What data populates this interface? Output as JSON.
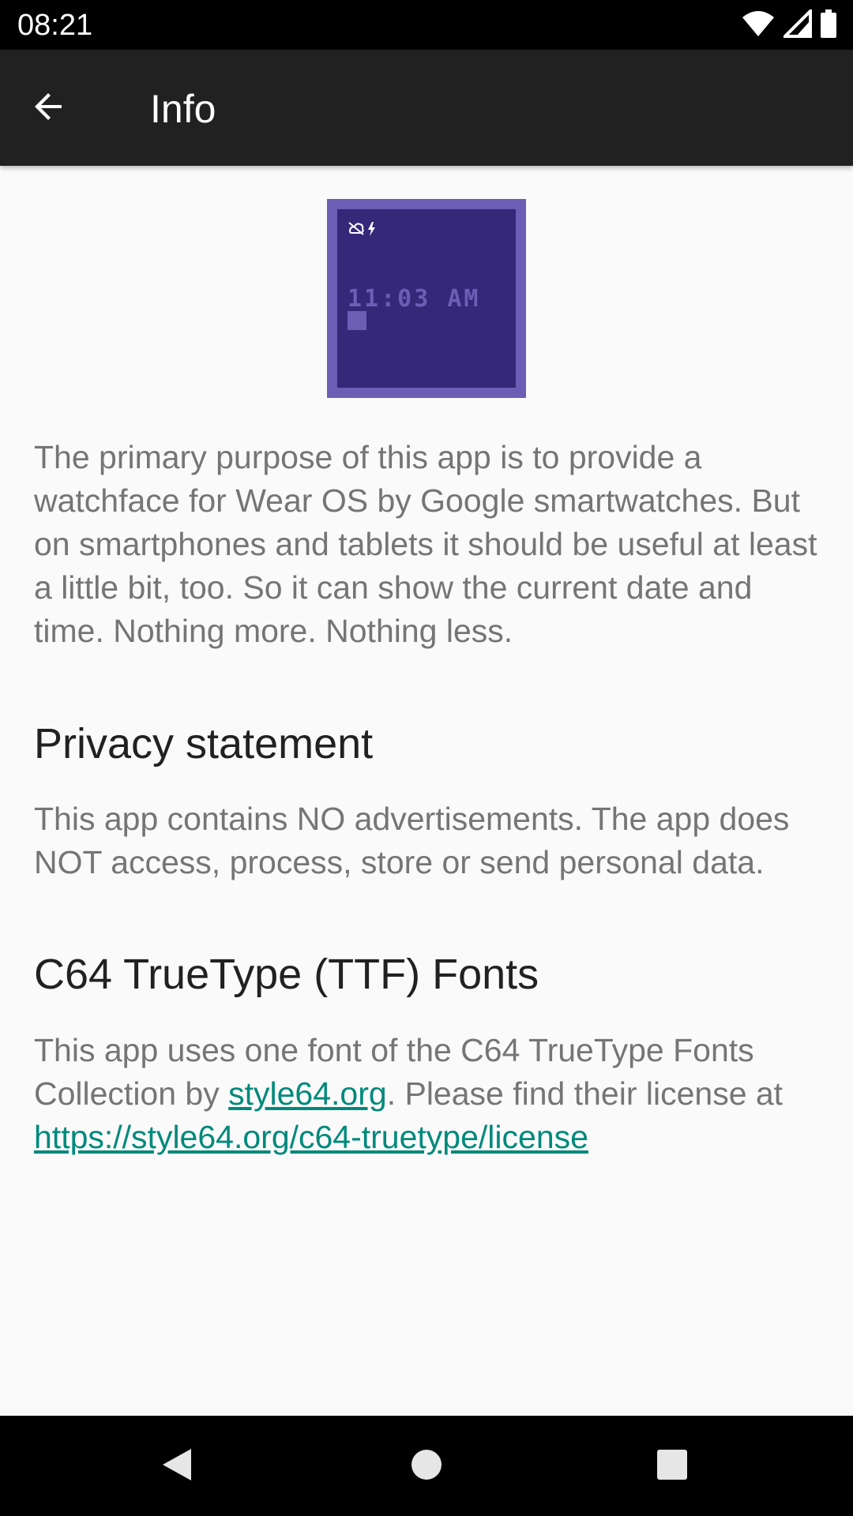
{
  "status_bar": {
    "time": "08:21",
    "icons": [
      "wifi-icon",
      "signal-icon",
      "battery-icon"
    ]
  },
  "app_bar": {
    "title": "Info",
    "back_icon": "arrow-back-icon"
  },
  "watchface_preview": {
    "time_text": "11:03 AM",
    "icons": [
      "cloud-off-icon",
      "charging-bolt-icon"
    ],
    "colors": {
      "border": "#6c5eb5",
      "screen": "#352879",
      "text": "#6c5eb5"
    }
  },
  "intro_text": "The primary purpose of this app is to provide a watchface for Wear OS by Google smartwatches. But on smartphones and tablets it should be useful at least a little bit, too. So it can show the current date and time. Nothing more. Nothing less.",
  "privacy": {
    "heading": "Privacy statement",
    "text": "This app contains NO advertisements. The app does NOT access, process, store or send personal data."
  },
  "fonts": {
    "heading": "C64 TrueType (TTF) Fonts",
    "text_before_link": "This app uses one font of the C64 TrueType Fonts Collection by ",
    "link1": "style64.org",
    "text_middle": ". Please find their license at ",
    "link2": "https://style64.org/c64-truetype/license"
  },
  "nav_bar": {
    "icons": [
      "back-triangle-icon",
      "home-circle-icon",
      "recents-square-icon"
    ]
  },
  "colors": {
    "app_bar": "#212121",
    "link": "#00897b",
    "body_text": "#757575",
    "heading_text": "#212121"
  }
}
